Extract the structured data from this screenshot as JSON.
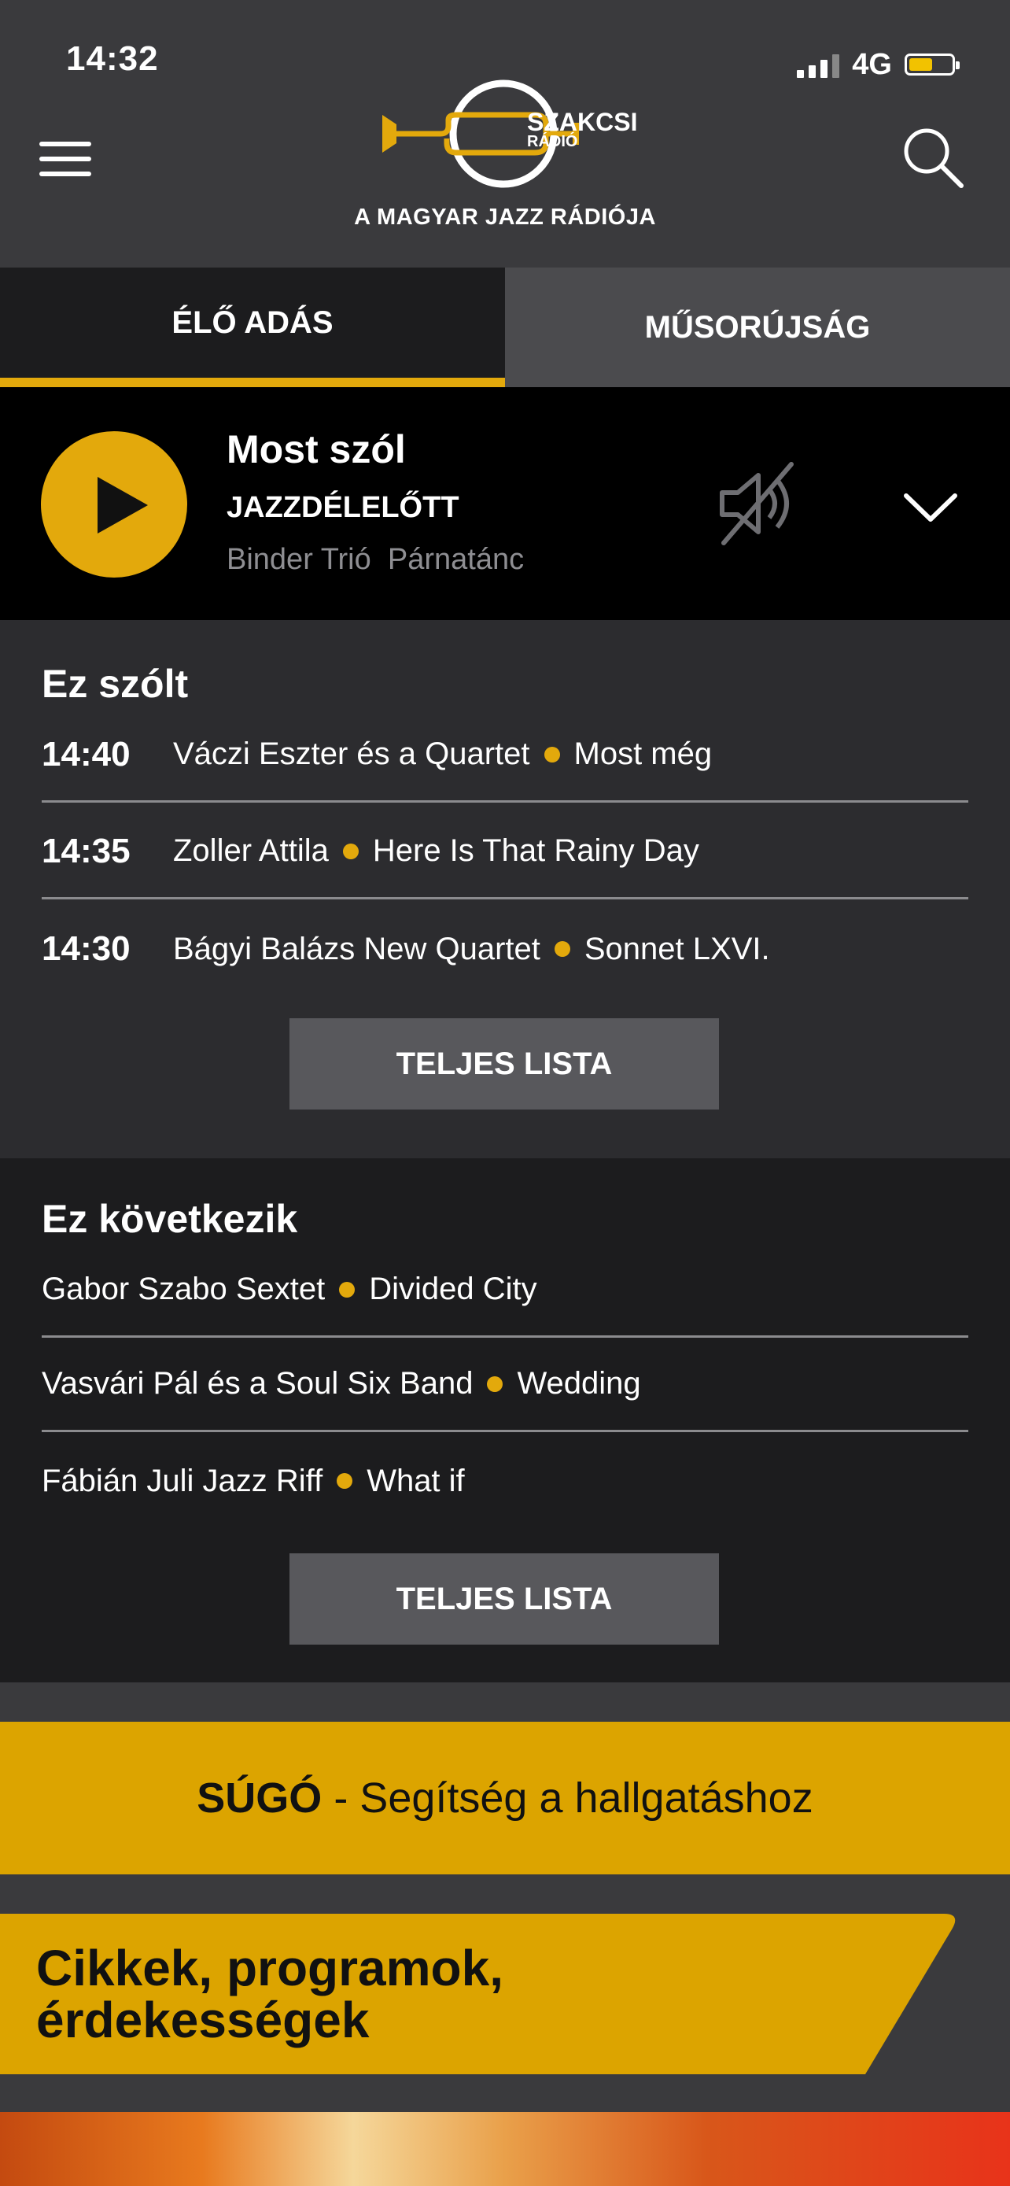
{
  "status_bar": {
    "time": "14:32",
    "network": "4G",
    "battery_level": 0.55
  },
  "header": {
    "brand_line1": "SZAKCSI",
    "brand_line2": "RÁDIÓ",
    "tagline": "A MAGYAR JAZZ RÁDIÓJA"
  },
  "tabs": {
    "live": "ÉLŐ ADÁS",
    "news": "MŰSORÚJSÁG"
  },
  "now_playing": {
    "title": "Most szól",
    "show": "JAZZDÉLELŐTT",
    "artist": "Binder Trió",
    "song": "Párnatánc"
  },
  "played": {
    "title": "Ez szólt",
    "items": [
      {
        "time": "14:40",
        "artist": "Váczi Eszter és a Quartet",
        "song": "Most még"
      },
      {
        "time": "14:35",
        "artist": "Zoller Attila",
        "song": "Here Is That Rainy Day"
      },
      {
        "time": "14:30",
        "artist": "Bágyi Balázs New Quartet",
        "song": "Sonnet LXVI."
      }
    ],
    "button": "TELJES LISTA"
  },
  "upcoming": {
    "title": "Ez következik",
    "items": [
      {
        "artist": "Gabor Szabo Sextet",
        "song": "Divided City"
      },
      {
        "artist": "Vasvári Pál és a Soul Six Band",
        "song": "Wedding"
      },
      {
        "artist": "Fábián Juli Jazz Riff",
        "song": "What if"
      }
    ],
    "button": "TELJES LISTA"
  },
  "help_banner": {
    "bold": "SÚGÓ",
    "rest": " - Segítség a hallgatáshoz"
  },
  "articles": {
    "line1": "Cikkek, programok,",
    "line2": "érdekességek"
  },
  "colors": {
    "accent": "#e3a90c",
    "banner": "#dca400",
    "background": "#3a3a3d"
  }
}
